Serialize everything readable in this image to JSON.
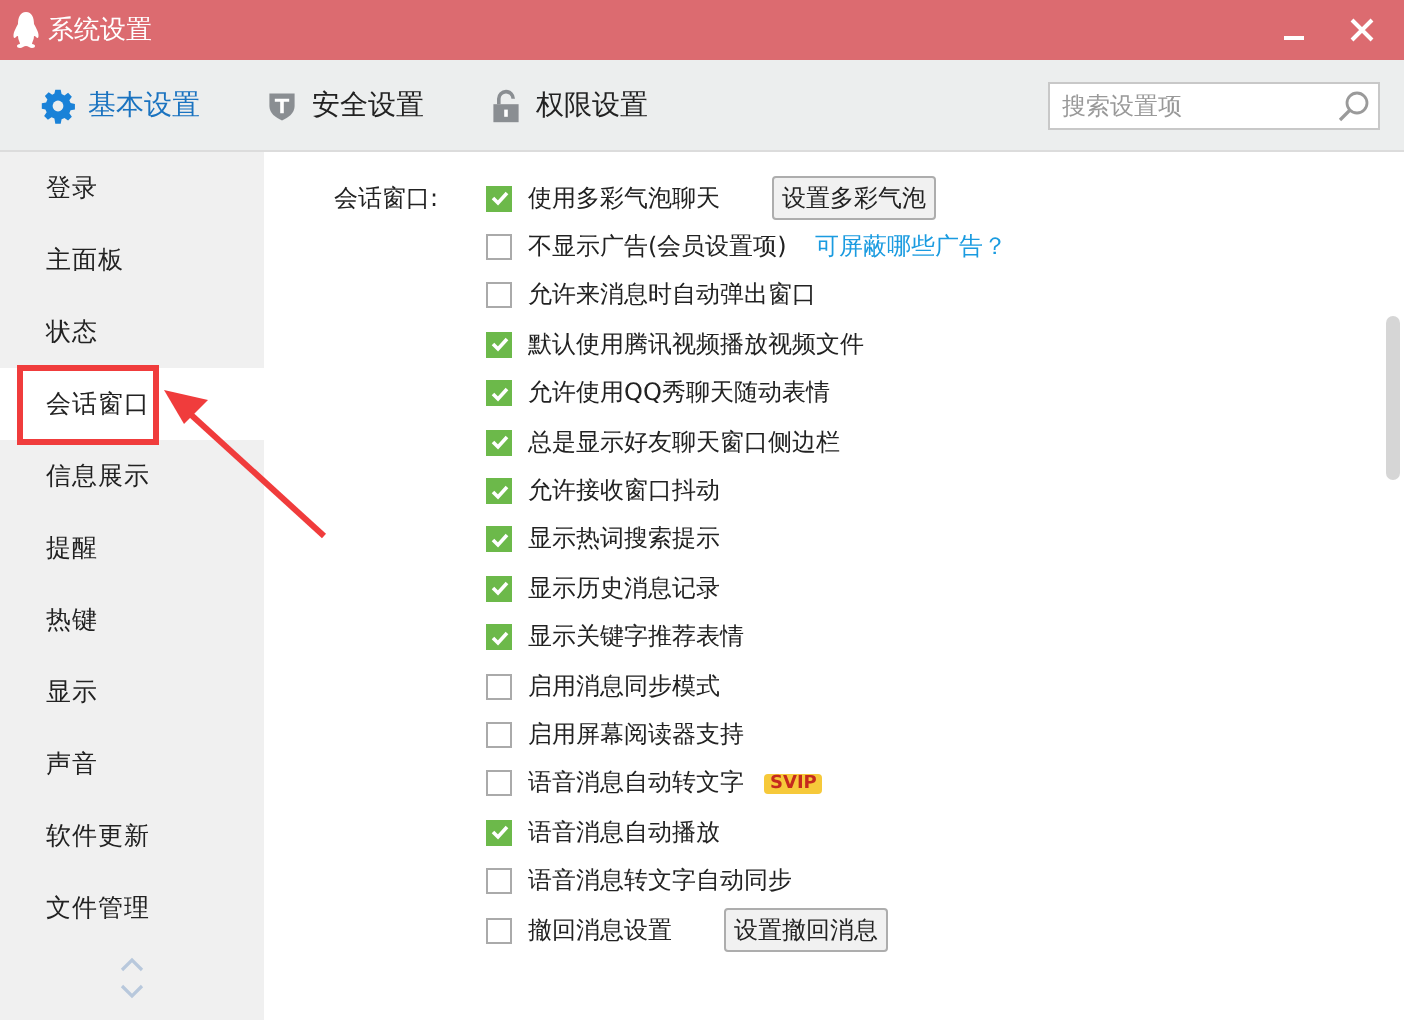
{
  "window": {
    "title": "系统设置"
  },
  "tabs": [
    {
      "label": "基本设置",
      "selected": true,
      "kind": "gear"
    },
    {
      "label": "安全设置",
      "selected": false,
      "kind": "shield"
    },
    {
      "label": "权限设置",
      "selected": false,
      "kind": "lock"
    }
  ],
  "search": {
    "placeholder": "搜索设置项"
  },
  "sidebar": {
    "items": [
      {
        "label": "登录",
        "selected": false
      },
      {
        "label": "主面板",
        "selected": false
      },
      {
        "label": "状态",
        "selected": false
      },
      {
        "label": "会话窗口",
        "selected": true
      },
      {
        "label": "信息展示",
        "selected": false
      },
      {
        "label": "提醒",
        "selected": false
      },
      {
        "label": "热键",
        "selected": false
      },
      {
        "label": "显示",
        "selected": false
      },
      {
        "label": "声音",
        "selected": false
      },
      {
        "label": "软件更新",
        "selected": false
      },
      {
        "label": "文件管理",
        "selected": false
      }
    ]
  },
  "section": {
    "label": "会话窗口:",
    "options": [
      {
        "label": "使用多彩气泡聊天",
        "checked": true,
        "button": "设置多彩气泡"
      },
      {
        "label": "不显示广告(会员设置项)",
        "checked": false,
        "link": "可屏蔽哪些广告？"
      },
      {
        "label": "允许来消息时自动弹出窗口",
        "checked": false
      },
      {
        "label": "默认使用腾讯视频播放视频文件",
        "checked": true
      },
      {
        "label": "允许使用QQ秀聊天随动表情",
        "checked": true
      },
      {
        "label": "总是显示好友聊天窗口侧边栏",
        "checked": true
      },
      {
        "label": "允许接收窗口抖动",
        "checked": true
      },
      {
        "label": "显示热词搜索提示",
        "checked": true
      },
      {
        "label": "显示历史消息记录",
        "checked": true
      },
      {
        "label": "显示关键字推荐表情",
        "checked": true
      },
      {
        "label": "启用消息同步模式",
        "checked": false
      },
      {
        "label": "启用屏幕阅读器支持",
        "checked": false
      },
      {
        "label": "语音消息自动转文字",
        "checked": false,
        "badge": "SVIP"
      },
      {
        "label": "语音消息自动播放",
        "checked": true
      },
      {
        "label": "语音消息转文字自动同步",
        "checked": false
      },
      {
        "label": "撤回消息设置",
        "checked": false,
        "button": "设置撤回消息"
      }
    ]
  }
}
